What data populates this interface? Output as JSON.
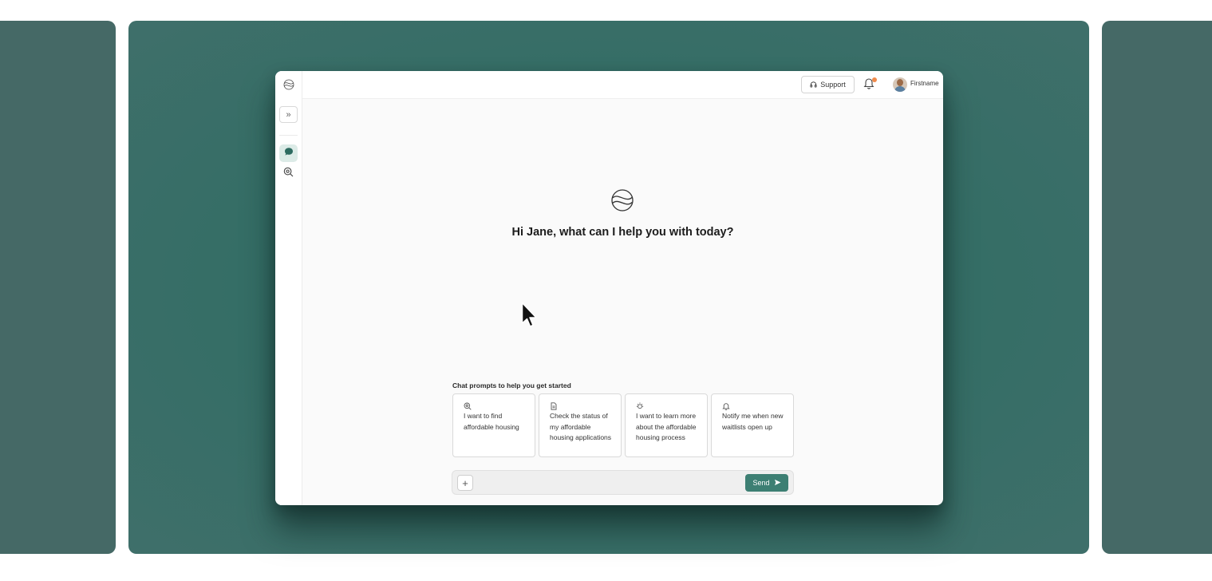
{
  "topbar": {
    "support_label": "Support",
    "user_name": "Firstname"
  },
  "main": {
    "greeting": "Hi Jane, what can I help you with today?",
    "prompts_title": "Chat prompts to help you get started",
    "prompts": [
      {
        "icon": "search-icon",
        "text": "I want to find affordable housing"
      },
      {
        "icon": "document-icon",
        "text": "Check the status of my affordable housing applications"
      },
      {
        "icon": "lightbulb-icon",
        "text": "I want to learn more about the affordable housing process"
      },
      {
        "icon": "bell-icon",
        "text": "Notify me when new waitlists open up"
      }
    ]
  },
  "composer": {
    "input_value": "",
    "input_placeholder": "",
    "send_label": "Send"
  },
  "colors": {
    "background_teal": "#356e66",
    "side_panel": "#456966",
    "send_button": "#3d7f73",
    "active_nav": "#dcebe7",
    "notification_dot": "#f08a4b"
  }
}
